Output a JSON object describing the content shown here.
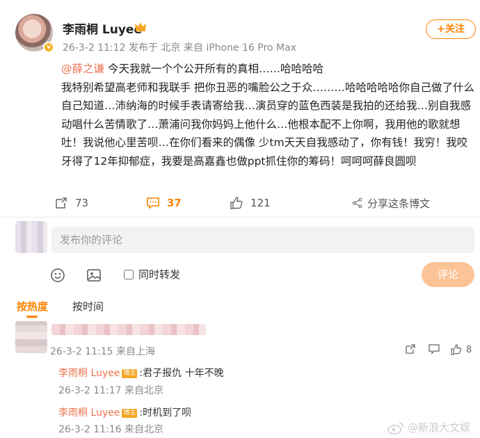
{
  "post": {
    "author": "李雨桐 Luyee",
    "meta": "26-3-2 11:12 发布于 北京 来自 iPhone 16 Pro Max",
    "follow_label": "+关注",
    "mention": "@薛之谦",
    "text_1": " 今天我就一个个公开所有的真相……",
    "hl_1": "哈哈哈哈",
    "text_2": "我特别希望高老师和我联手 把你丑恶的嘴脸公之于众………",
    "hl_2": "哈哈哈哈哈",
    "text_3": "你自己做了什么自己知道…沛纳海的时候手表请寄给我…演员穿的蓝色西装是我拍的还给我…别自我感动唱什么苦情歌了…萧浦问我你妈妈上他什么…他根本配不上你啊，我用他的歌就想吐！我说他心里苦呗…在你们看来的偶像 少tm天天自我感动了，你有钱！我穷！我咬牙得了12年抑郁症，我要是高嘉鑫也做ppt抓住你的筹码！呵呵呵薛良圆呗"
  },
  "actions": {
    "repost_count": "73",
    "comment_count": "37",
    "like_count": "121",
    "share_label": "分享这条博文"
  },
  "composer": {
    "placeholder": "发布你的评论",
    "also_repost_label": "同时转发",
    "submit_label": "评论"
  },
  "sort": {
    "hot": "按热度",
    "time": "按时间"
  },
  "comments": [
    {
      "meta": "26-3-2 11:15 来自上海",
      "like_count": "8",
      "replies": [
        {
          "name": "李雨桐 Luyee",
          "badge": "博主",
          "text": ":君子报仇 十年不晚",
          "meta": "26-3-2 11:17 来自北京"
        },
        {
          "name": "李雨桐 Luyee",
          "badge": "博主",
          "text": ":时机到了呗",
          "meta": "26-3-2 11:16 来自北京"
        }
      ]
    }
  ],
  "watermark": "@新浪大文娱",
  "colors": {
    "accent": "#ff8200",
    "mention": "#eb7350",
    "submit_disabled": "#fbc497"
  }
}
